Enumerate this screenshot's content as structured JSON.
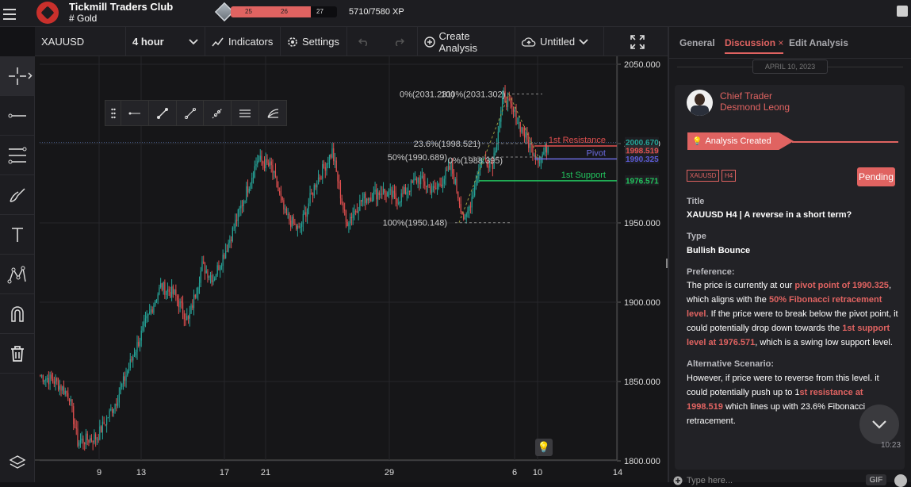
{
  "header": {
    "title": "Tickmill Traders Club",
    "subtitle": "# Gold",
    "xp_levels": [
      "25",
      "26",
      "27"
    ],
    "xp_progress": 0.75,
    "xp_text": "5710/7580 XP"
  },
  "toolbar": {
    "symbol": "XAUUSD",
    "timeframe": "4 hour",
    "indicators": "Indicators",
    "settings": "Settings",
    "create_analysis": "Create Analysis",
    "untitled": "Untitled"
  },
  "panel": {
    "tabs": [
      "General",
      "Discussion",
      "Edit Analysis"
    ],
    "date": "APRIL 10, 2023",
    "role": "Chief Trader",
    "author": "Desmond Leong",
    "banner": "Analysis Created",
    "tags": [
      "XAUUSD",
      "H4"
    ],
    "status": "Pending",
    "title_label": "Title",
    "title_value": "XAUUSD H4 | A reverse in a short term?",
    "type_label": "Type",
    "type_value": "Bullish Bounce",
    "pref_label": "Preference:",
    "pref_1": "The price is currently at our ",
    "pref_hl1": "pivot point of 1990.325",
    "pref_2": ", which aligns with the ",
    "pref_hl2": "50% Fibonacci retracement level",
    "pref_3": ". If the price were to break below the pivot point, it could potentially drop down towards the ",
    "pref_hl3": "1st support level at 1976.571",
    "pref_4": ", which is a swing low support level.",
    "alt_label": "Alternative Scenario:",
    "alt_1": "However, if price  were to reverse from this level. it could potentially push up to 1",
    "alt_hl1": "st resistance at 1998.519",
    "alt_2": " which lines up with 23.6% Fibonacci retracement.",
    "time": "10:23",
    "input_placeholder": "Type here...",
    "gif": "GIF"
  },
  "chart_data": {
    "type": "candlestick",
    "symbol": "XAUUSD",
    "ylim": [
      1800,
      2050
    ],
    "yticks": [
      "2050.000",
      "2000.000",
      "1950.000",
      "1900.000",
      "1850.000",
      "1800.000"
    ],
    "xticks": [
      "9",
      "13",
      "17",
      "21",
      "29",
      "6",
      "10",
      "14"
    ],
    "price_labels": [
      {
        "text": "2000.670",
        "color": "#26a69a"
      },
      {
        "text": "1998.519",
        "color": "#e35050"
      },
      {
        "text": "1990.325",
        "color": "#5b5bd6"
      },
      {
        "text": "1976.571",
        "color": "#22c55e"
      }
    ],
    "levels": [
      {
        "name": "1st Resistance",
        "price": 1998.519,
        "color": "#e35050"
      },
      {
        "name": "Pivot",
        "price": 1990.325,
        "color": "#6b6be0"
      },
      {
        "name": "1st Support",
        "price": 1976.571,
        "color": "#22c55e"
      }
    ],
    "fib_labels": [
      "0%(2031.231)",
      "100%(2031.302)",
      "23.6%(1998.521)",
      "50%(1990.689)",
      "0%(1988.395)",
      "100%(1950.148)"
    ]
  }
}
